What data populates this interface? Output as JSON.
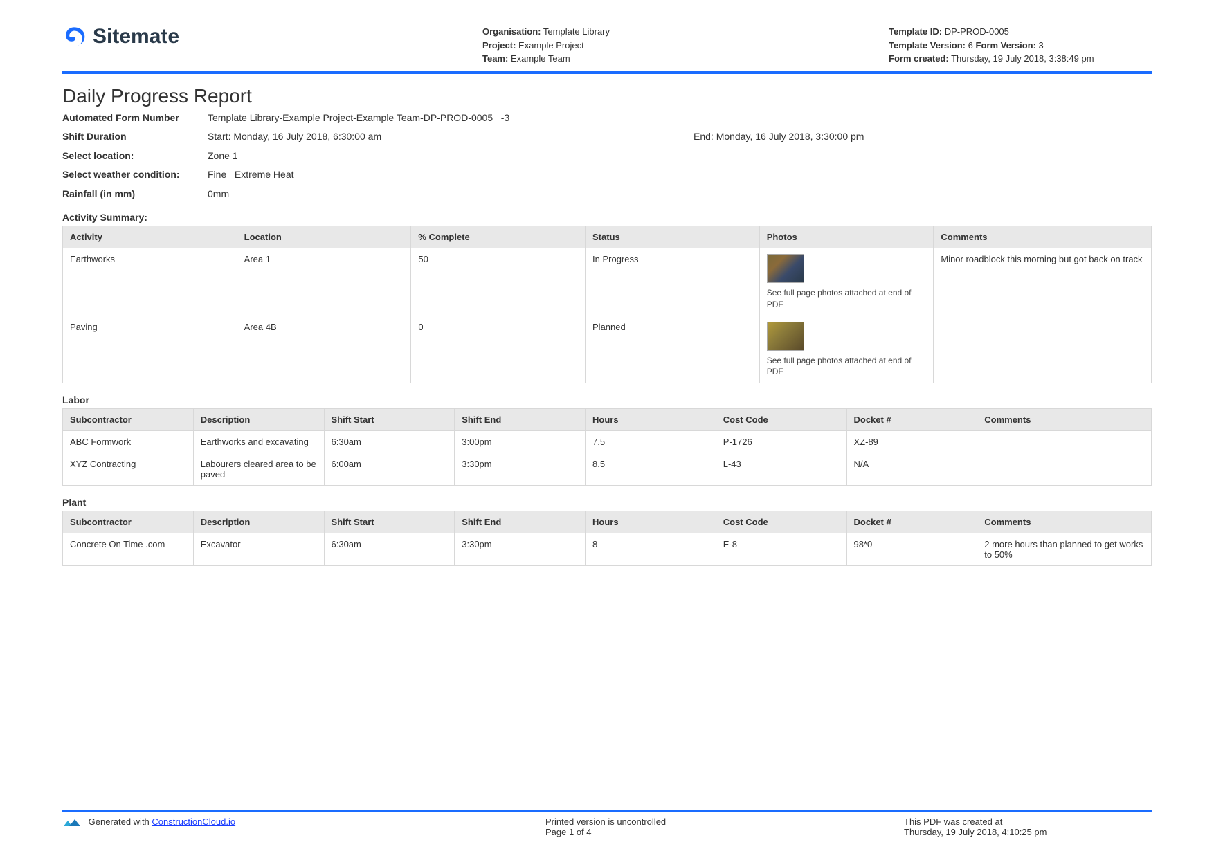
{
  "header": {
    "brand": "Sitemate",
    "org_label": "Organisation:",
    "org_value": "Template Library",
    "project_label": "Project:",
    "project_value": "Example Project",
    "team_label": "Team:",
    "team_value": "Example Team",
    "template_id_label": "Template ID:",
    "template_id_value": "DP-PROD-0005",
    "template_version_label": "Template Version:",
    "template_version_value": "6",
    "form_version_label": "Form Version:",
    "form_version_value": "3",
    "form_created_label": "Form created:",
    "form_created_value": "Thursday, 19 July 2018, 3:38:49 pm"
  },
  "title": "Daily Progress Report",
  "fields": {
    "auto_form_number_label": "Automated Form Number",
    "auto_form_number_value": "Template Library-Example Project-Example Team-DP-PROD-0005   -3",
    "shift_duration_label": "Shift Duration",
    "shift_start": "Start: Monday, 16 July 2018, 6:30:00 am",
    "shift_end": "End: Monday, 16 July 2018, 3:30:00 pm",
    "location_label": "Select location:",
    "location_value": "Zone 1",
    "weather_label": "Select weather condition:",
    "weather_value": "Fine   Extreme Heat",
    "rainfall_label": "Rainfall (in mm)",
    "rainfall_value": "0mm"
  },
  "activity": {
    "title": "Activity Summary:",
    "headers": [
      "Activity",
      "Location",
      "% Complete",
      "Status",
      "Photos",
      "Comments"
    ],
    "photo_note": "See full page photos attached at end of PDF",
    "rows": [
      {
        "activity": "Earthworks",
        "location": "Area 1",
        "complete": "50",
        "status": "In Progress",
        "comments": "Minor roadblock this morning but got back on track"
      },
      {
        "activity": "Paving",
        "location": "Area 4B",
        "complete": "0",
        "status": "Planned",
        "comments": ""
      }
    ]
  },
  "labor": {
    "title": "Labor",
    "headers": [
      "Subcontractor",
      "Description",
      "Shift Start",
      "Shift End",
      "Hours",
      "Cost Code",
      "Docket #",
      "Comments"
    ],
    "rows": [
      {
        "sub": "ABC Formwork",
        "desc": "Earthworks and excavating",
        "start": "6:30am",
        "end": "3:00pm",
        "hours": "7.5",
        "cost": "P-1726",
        "docket": "XZ-89",
        "comments": ""
      },
      {
        "sub": "XYZ Contracting",
        "desc": "Labourers cleared area to be paved",
        "start": "6:00am",
        "end": "3:30pm",
        "hours": "8.5",
        "cost": "L-43",
        "docket": "N/A",
        "comments": ""
      }
    ]
  },
  "plant": {
    "title": "Plant",
    "headers": [
      "Subcontractor",
      "Description",
      "Shift Start",
      "Shift End",
      "Hours",
      "Cost Code",
      "Docket #",
      "Comments"
    ],
    "rows": [
      {
        "sub": "Concrete On Time .com",
        "desc": "Excavator",
        "start": "6:30am",
        "end": "3:30pm",
        "hours": "8",
        "cost": "E-8",
        "docket": "98*0",
        "comments": "2 more hours than planned to get works to 50%"
      }
    ]
  },
  "footer": {
    "generated_prefix": "Generated with ",
    "generated_link": "ConstructionCloud.io",
    "uncontrolled": "Printed version is uncontrolled",
    "page": "Page 1 of 4",
    "created_label": "This PDF was created at",
    "created_value": "Thursday, 19 July 2018, 4:10:25 pm"
  }
}
